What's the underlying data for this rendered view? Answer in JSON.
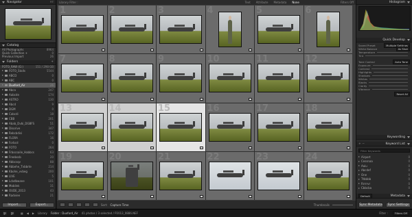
{
  "left": {
    "navigator": {
      "title": "Navigator",
      "zoom": [
        "FIT",
        "FILL",
        "1:1",
        "3:1"
      ]
    },
    "catalog": {
      "title": "Catalog",
      "items": [
        {
          "label": "All Photographs",
          "count": "8964"
        },
        {
          "label": "Quick Collection +",
          "count": "0"
        },
        {
          "label": "Previous Import",
          "count": "26"
        }
      ]
    },
    "folders": {
      "title": "Folders",
      "volume": {
        "label": "FOTO_RAW (G:)",
        "info": "151 / 298 GB"
      },
      "items": [
        {
          "label": "FOTO_Stalls",
          "count": "5544",
          "selected": false
        },
        {
          "label": "ABCD",
          "count": "0",
          "selected": false
        },
        {
          "label": "ABC",
          "count": "0",
          "selected": false
        },
        {
          "label": "Duxford_Air",
          "count": "26",
          "selected": true
        },
        {
          "label": "Abca",
          "count": "247",
          "selected": false
        },
        {
          "label": "Aabcde",
          "count": "174",
          "selected": false
        },
        {
          "label": "ASTRO",
          "count": "130",
          "selected": false
        },
        {
          "label": "Abcd",
          "count": "9",
          "selected": false
        },
        {
          "label": "DGM",
          "count": "0",
          "selected": false
        },
        {
          "label": "Cabcdi",
          "count": "18",
          "selected": false
        },
        {
          "label": "CBB",
          "count": "201",
          "selected": false
        },
        {
          "label": "Abab_Dvbi_DGBFS",
          "count": "51",
          "selected": false
        },
        {
          "label": "Disorive",
          "count": "347",
          "selected": false
        },
        {
          "label": "Rebcbdisi",
          "count": "172",
          "selected": false
        },
        {
          "label": "FLORA",
          "count": "16",
          "selected": false
        },
        {
          "label": "Forbcd",
          "count": "0",
          "selected": false
        },
        {
          "label": "FOTO",
          "count": "264",
          "selected": false
        },
        {
          "label": "Frbocsaile_Habbcs",
          "count": "63",
          "selected": false
        },
        {
          "label": "Freebssb",
          "count": "20",
          "selected": false
        },
        {
          "label": "Abbcsqv",
          "count": "88",
          "selected": false
        },
        {
          "label": "Abbehe_Tvbbrte",
          "count": "214",
          "selected": false
        },
        {
          "label": "Kbohe_vvbeg",
          "count": "200",
          "selected": false
        },
        {
          "label": "LIVE",
          "count": "5",
          "selected": false
        },
        {
          "label": "Lcbdbwane",
          "count": "101",
          "selected": false
        },
        {
          "label": "Mobilek",
          "count": "31",
          "selected": false
        },
        {
          "label": "OUDE_2013",
          "count": "43",
          "selected": false
        },
        {
          "label": "Radviee",
          "count": "21",
          "selected": false
        }
      ]
    },
    "import_label": "Import...",
    "export_label": "Export..."
  },
  "center": {
    "filter_bar": {
      "title": "Library Filter :",
      "options": [
        "Text",
        "Attribute",
        "Metadata",
        "None"
      ],
      "active": "None",
      "filters_off": "Filters Off"
    },
    "cells": [
      {
        "n": "1",
        "kind": "plane",
        "state": ""
      },
      {
        "n": "2",
        "kind": "plane",
        "state": ""
      },
      {
        "n": "3",
        "kind": "plane",
        "state": ""
      },
      {
        "n": "4",
        "kind": "person",
        "state": ""
      },
      {
        "n": "5",
        "kind": "plane",
        "state": ""
      },
      {
        "n": "6",
        "kind": "person",
        "state": ""
      },
      {
        "n": "7",
        "kind": "plane",
        "state": ""
      },
      {
        "n": "8",
        "kind": "plane",
        "state": ""
      },
      {
        "n": "9",
        "kind": "plane",
        "state": ""
      },
      {
        "n": "10",
        "kind": "plane",
        "state": ""
      },
      {
        "n": "11",
        "kind": "plane",
        "state": ""
      },
      {
        "n": "12",
        "kind": "plane",
        "state": ""
      },
      {
        "n": "13",
        "kind": "plane",
        "state": "selected"
      },
      {
        "n": "14",
        "kind": "plane",
        "state": "selected"
      },
      {
        "n": "15",
        "kind": "plane",
        "state": "primary"
      },
      {
        "n": "16",
        "kind": "plane",
        "state": ""
      },
      {
        "n": "17",
        "kind": "plane",
        "state": ""
      },
      {
        "n": "18",
        "kind": "plane",
        "state": ""
      },
      {
        "n": "19",
        "kind": "plane",
        "state": ""
      },
      {
        "n": "20",
        "kind": "dark",
        "state": ""
      },
      {
        "n": "21",
        "kind": "plane",
        "state": ""
      },
      {
        "n": "22",
        "kind": "sky",
        "state": ""
      },
      {
        "n": "23",
        "kind": "sky",
        "state": ""
      },
      {
        "n": "24",
        "kind": "plane",
        "state": ""
      }
    ],
    "toolbar": {
      "sort_label": "Sort:",
      "sort_value": "Capture Time",
      "thumbnails_label": "Thumbnails"
    }
  },
  "right": {
    "histogram": {
      "title": "Histogram"
    },
    "quick_develop": {
      "title": "Quick Develop",
      "saved_preset": {
        "label": "Saved Preset",
        "value": "Multiple Settings"
      },
      "white_balance": {
        "label": "White Balance",
        "value": "As Shot"
      },
      "temperature": "Temperature",
      "tint": "Tint",
      "tone_control": {
        "label": "Tone Control",
        "value": "Auto Tone"
      },
      "sliders": [
        "Exposure",
        "Contrast",
        "Highlights",
        "Shadows",
        "Whites",
        "Blacks",
        "Clarity",
        "Vibrance"
      ],
      "reset_all": "Reset All"
    },
    "keywording": {
      "title": "Keywording"
    },
    "keyword_list": {
      "title": "Keyword List",
      "filter_placeholder": "Filter Keywords",
      "items": [
        {
          "label": "Airport",
          "count": "0"
        },
        {
          "label": "Cessnaa",
          "count": "0"
        },
        {
          "label": "Aaiu",
          "count": "0"
        },
        {
          "label": "Abcdef",
          "count": "0"
        },
        {
          "label": "One",
          "count": "0"
        },
        {
          "label": "Ttbbbb",
          "count": "0"
        },
        {
          "label": "Rrrrrvr",
          "count": "0"
        },
        {
          "label": "Cbbcba",
          "count": "0"
        }
      ]
    },
    "metadata": {
      "title": "Metadata",
      "preset": "Default"
    },
    "sync_metadata": "Sync Metadata",
    "sync_settings": "Sync Settings"
  },
  "filmstrip": {
    "pages": [
      "1",
      "2"
    ],
    "section": "Library",
    "path_label": "Folder : Duxford_Air",
    "status": "41 photos / 3 selected / P2013_0886.NEF",
    "filter_label": "Filter :",
    "filter_value": "Filters Off"
  }
}
